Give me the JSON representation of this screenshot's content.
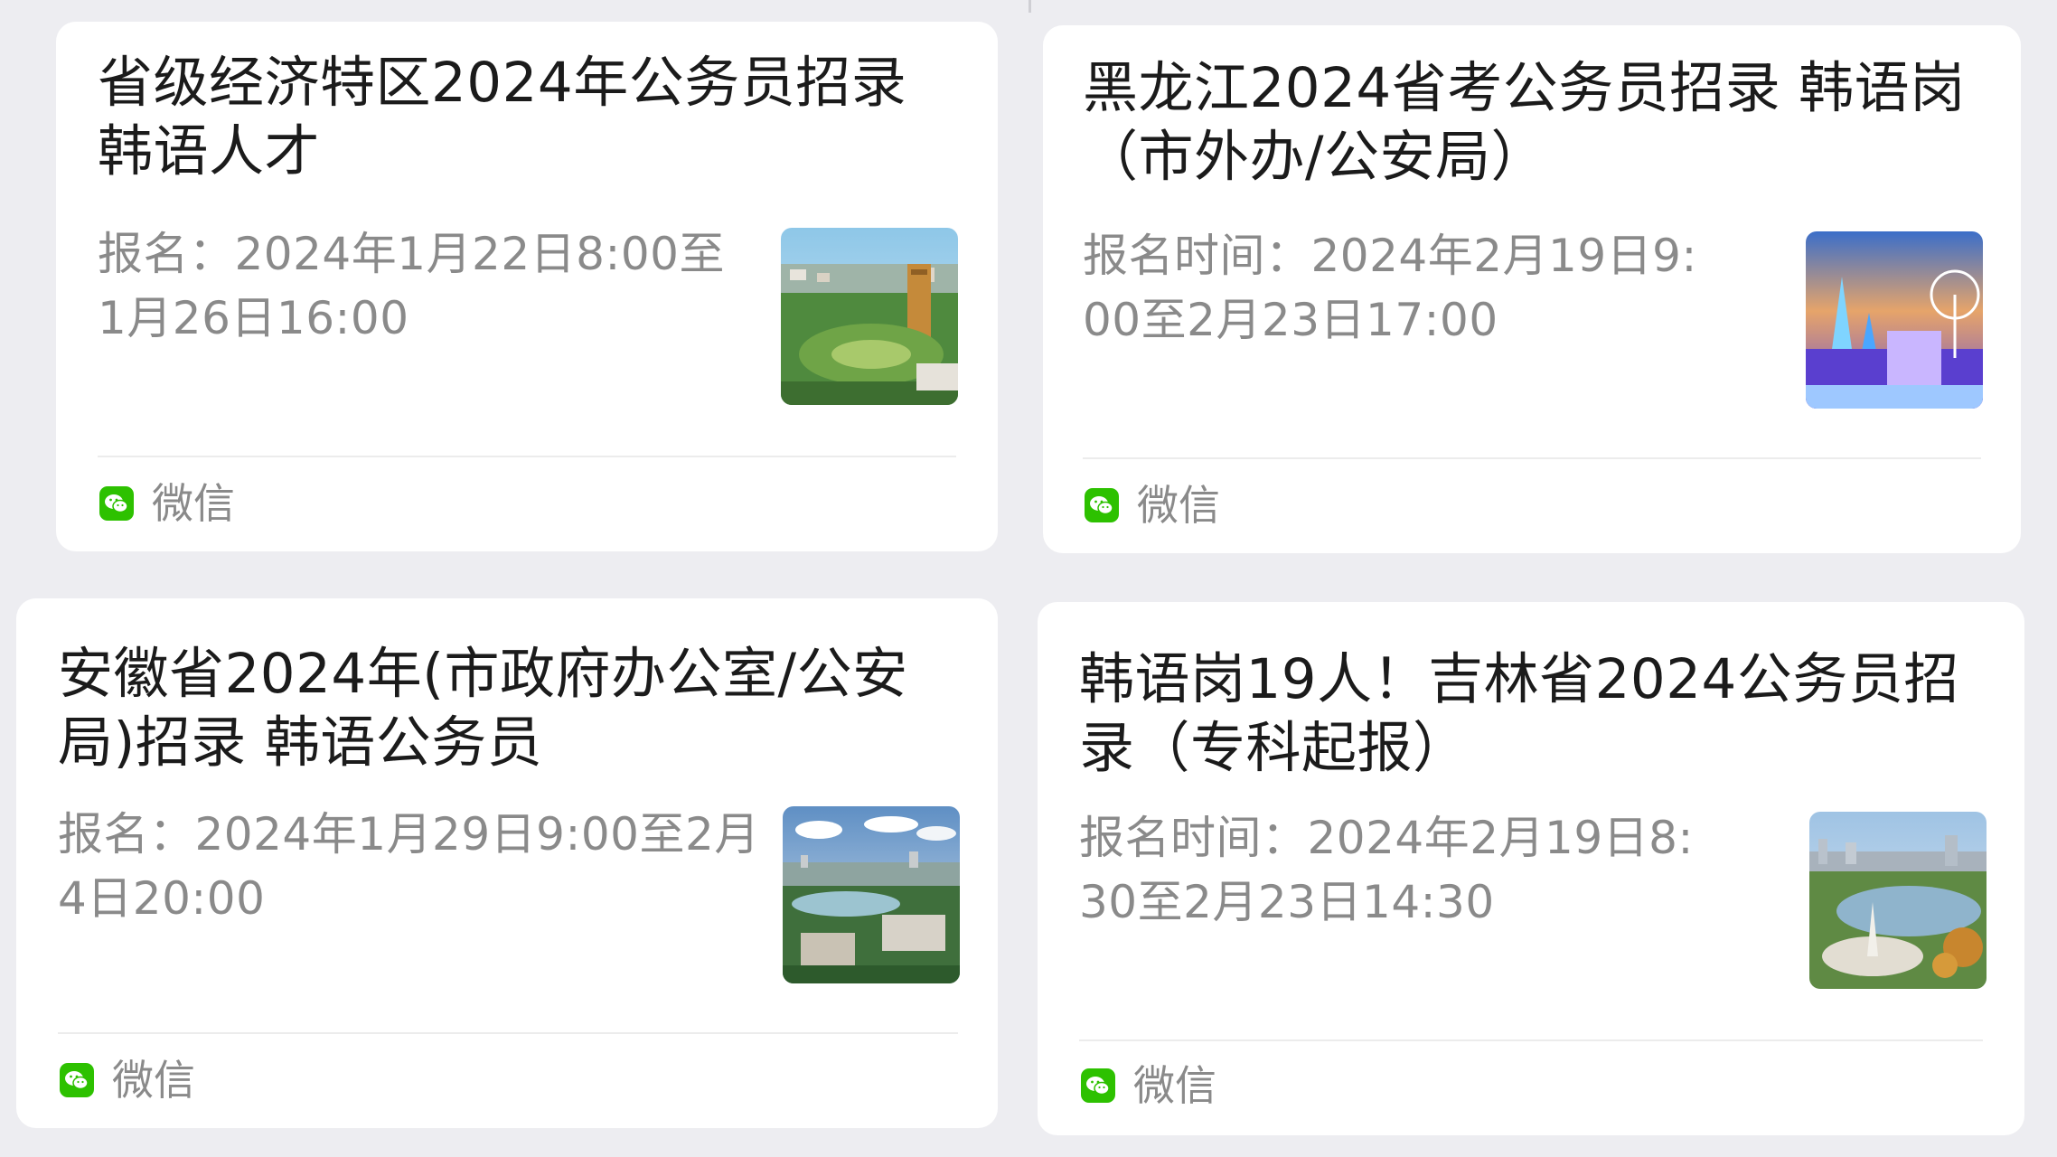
{
  "cards": [
    {
      "title": "省级经济特区2024年公务员招录韩语人才",
      "desc": "报名：2024年1月22日8:00至1月26日16:00",
      "thumb_icon": "city-aerial-park-thumbnail",
      "source_icon": "wechat-icon",
      "source": "微信"
    },
    {
      "title": "黑龙江2024省考公务员招录 韩语岗（市外办/公安局）",
      "desc": "报名时间：2024年2月19日9:00至2月23日17:00",
      "thumb_icon": "ice-castle-ferris-wheel-thumbnail",
      "source_icon": "wechat-icon",
      "source": "微信"
    },
    {
      "title": "安徽省2024年(市政府办公室/公安局)招录 韩语公务员",
      "desc": "报名：2024年1月29日9:00至2月4日20:00",
      "thumb_icon": "lake-city-skyline-thumbnail",
      "source_icon": "wechat-icon",
      "source": "微信"
    },
    {
      "title": "韩语岗19人！吉林省2024公务员招录（专科起报）",
      "desc": "报名时间：2024年2月19日8:30至2月23日14:30",
      "thumb_icon": "lakeside-monument-plaza-thumbnail",
      "source_icon": "wechat-icon",
      "source": "微信"
    }
  ],
  "colors": {
    "background": "#ededf1",
    "card": "#ffffff",
    "title": "#1b1b1b",
    "desc": "#8a8a8a",
    "wechat_green": "#2dc100"
  }
}
